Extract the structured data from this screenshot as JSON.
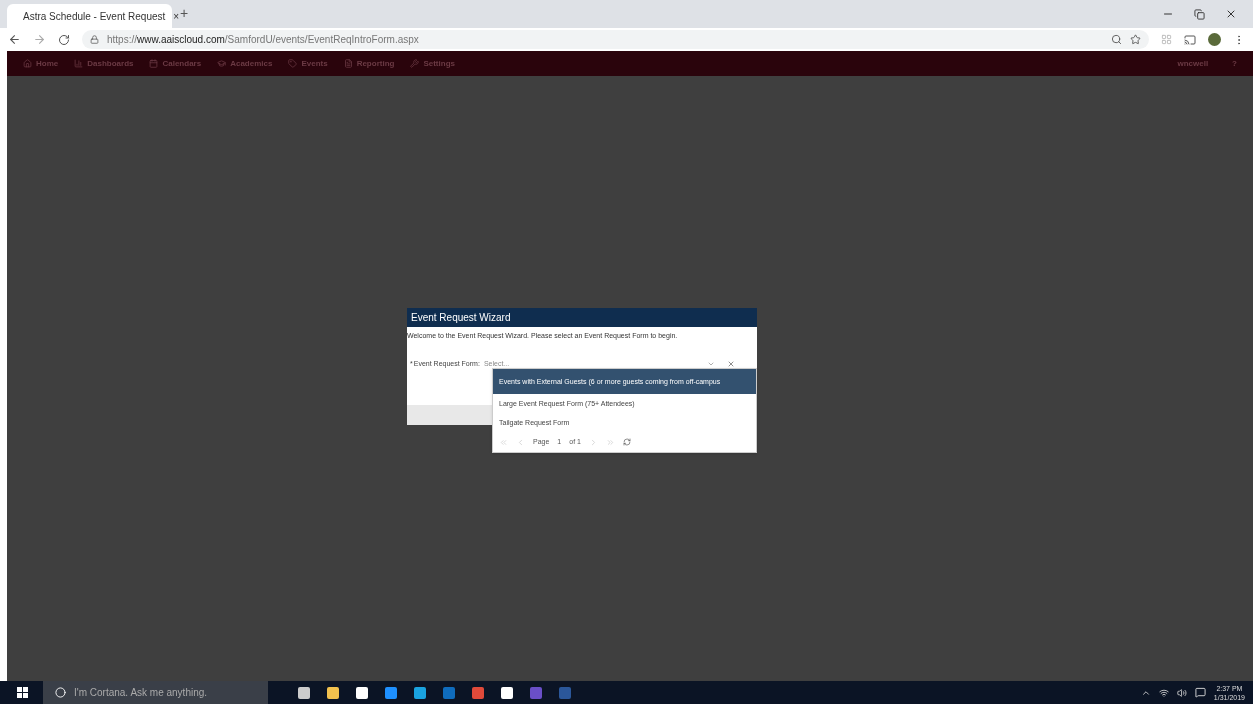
{
  "browser": {
    "tab_title": "Astra Schedule - Event Request",
    "tab_close": "×",
    "new_tab": "+",
    "url_prefix": "https://",
    "url_domain": "www.aaiscloud.com",
    "url_path": "/SamfordU/events/EventReqIntroForm.aspx"
  },
  "nav": {
    "items": [
      {
        "label": "Home",
        "kind": "home"
      },
      {
        "label": "Dashboards",
        "kind": "chart"
      },
      {
        "label": "Calendars",
        "kind": "calendar"
      },
      {
        "label": "Academics",
        "kind": "cap"
      },
      {
        "label": "Events",
        "kind": "tag"
      },
      {
        "label": "Reporting",
        "kind": "file"
      },
      {
        "label": "Settings",
        "kind": "wrench"
      }
    ],
    "user": "wncwell",
    "help": "?"
  },
  "dialog": {
    "title": "Event Request Wizard",
    "intro": "Welcome to the Event Request Wizard. Please select an Event Request Form to begin.",
    "required_mark": "*",
    "field_label": "Event Request Form:",
    "placeholder": "Select...",
    "options": [
      {
        "label": "Events with External Guests (6 or more guests coming from off-campus",
        "selected": true
      },
      {
        "label": "Large Event Request Form (75+ Attendees)",
        "selected": false
      },
      {
        "label": "Tailgate Request Form",
        "selected": false
      }
    ],
    "pager": {
      "page_label": "Page",
      "page": "1",
      "of": "of 1"
    }
  },
  "taskbar": {
    "search_placeholder": "I'm Cortana. Ask me anything.",
    "time": "2:37 PM",
    "date": "1/31/2019"
  }
}
